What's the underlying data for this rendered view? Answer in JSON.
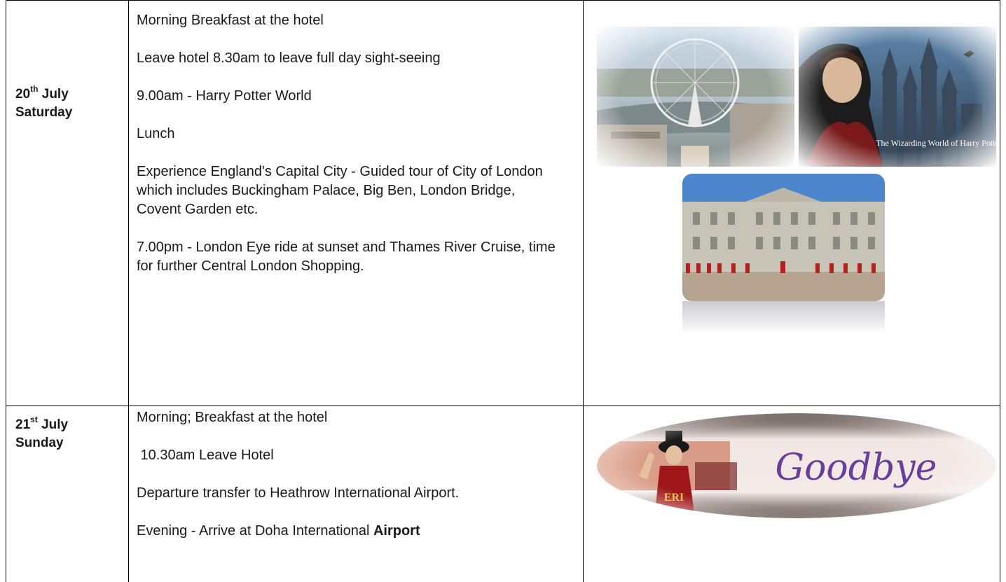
{
  "rows": [
    {
      "day_num": "20",
      "day_suffix": "th",
      "month": "July",
      "weekday": "Saturday",
      "activities": [
        "Morning Breakfast at the hotel",
        "Leave hotel 8.30am to leave full day sight-seeing",
        "9.00am - Harry Potter World",
        "Lunch",
        "Experience England's Capital City - Guided tour of City of London which includes Buckingham Palace, Big Ben, London Bridge, Covent Garden etc.",
        "7.00pm - London Eye ride at sunset and Thames River Cruise, time for further Central London Shopping."
      ],
      "images": {
        "london_eye": "London Eye aerial view",
        "harry_potter_brand": "The Wizarding World of Harry Potter",
        "palace": "Buckingham Palace guards"
      }
    },
    {
      "day_num": "21",
      "day_suffix": "st",
      "month": "July",
      "weekday": "Sunday",
      "activities": [
        "Morning; Breakfast at the hotel",
        " 10.30am Leave Hotel",
        "Departure transfer to Heathrow International Airport."
      ],
      "last_activity_prefix": "Evening - Arrive at Doha International ",
      "last_activity_bold": "Airport",
      "goodbye_text": "Goodbye",
      "badge_text": "ERI"
    }
  ],
  "colors": {
    "border": "#000000",
    "text": "#1a1a1a",
    "goodbye": "#6a3d9a"
  }
}
